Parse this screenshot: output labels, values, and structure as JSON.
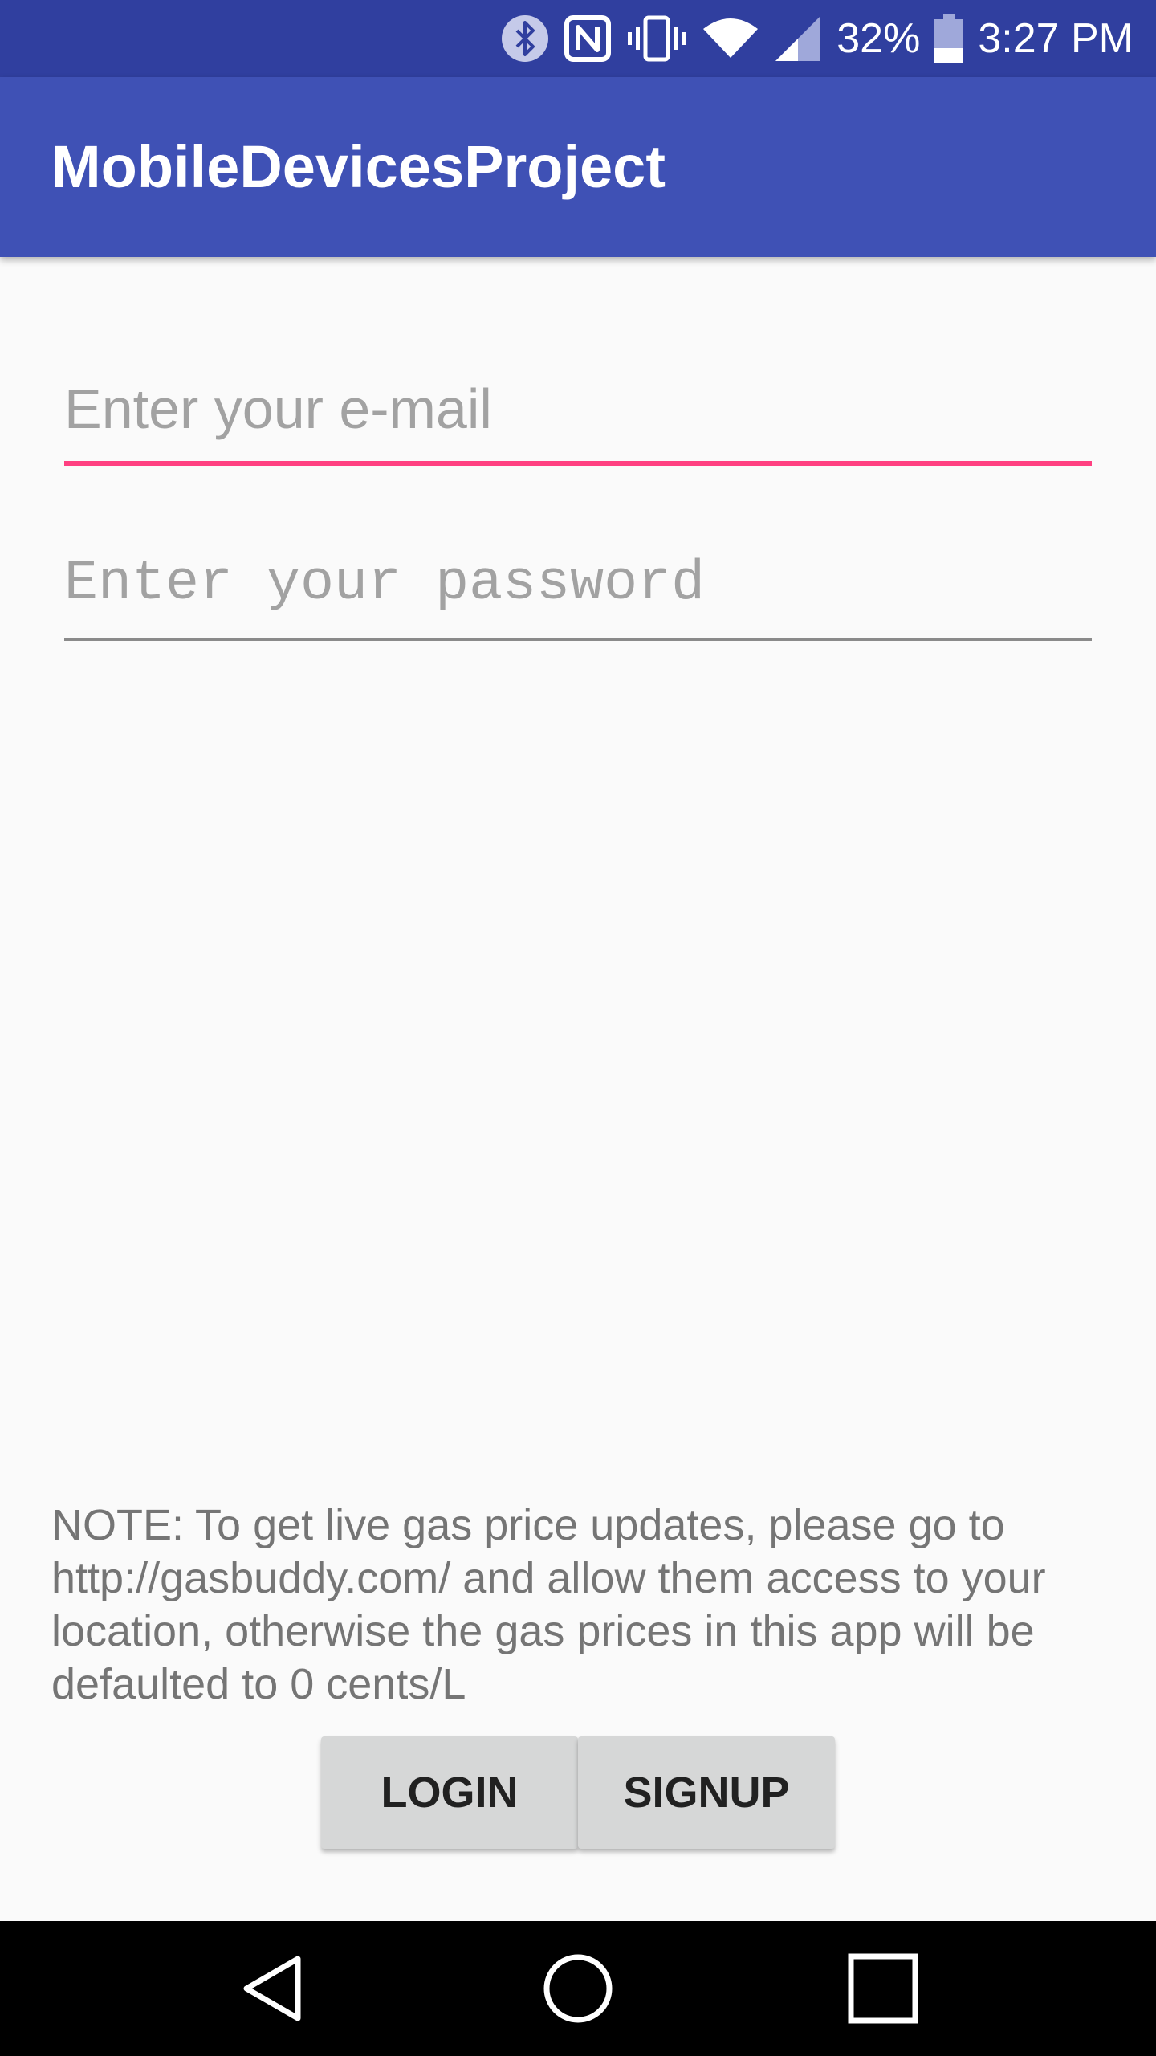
{
  "status_bar": {
    "battery_percent": "32%",
    "time": "3:27 PM",
    "battery_level": 0.32,
    "icons": [
      "bluetooth-icon",
      "nfc-icon",
      "vibrate-icon",
      "wifi-icon",
      "signal-icon",
      "battery-icon"
    ]
  },
  "app_bar": {
    "title": "MobileDevicesProject"
  },
  "login_form": {
    "email_placeholder": "Enter your e-mail",
    "password_placeholder": "Enter your password"
  },
  "note": "NOTE: To get live gas price updates, please go to http://gasbuddy.com/ and allow them access to your location, otherwise the gas prices in this app will be defaulted to 0 cents/L",
  "buttons": {
    "login_label": "LOGIN",
    "signup_label": "SIGNUP"
  },
  "nav_bar": {
    "icons": [
      "back-icon",
      "home-icon",
      "recents-icon"
    ]
  },
  "colors": {
    "status_bar": "#303f9f",
    "app_bar": "#3f51b5",
    "accent": "#ff4081",
    "background": "#fafafa",
    "button": "#d6d7d7"
  }
}
